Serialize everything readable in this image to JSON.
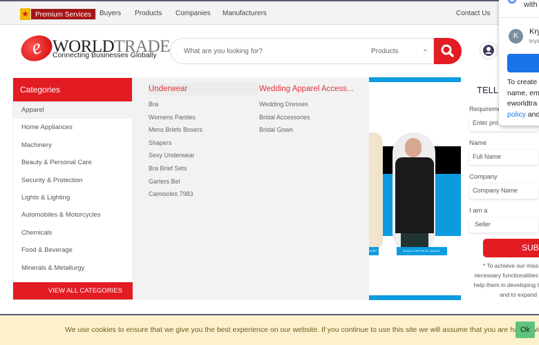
{
  "topnav": {
    "premium": "Premium Services",
    "items": [
      "Buyers",
      "Products",
      "Companies",
      "Manufacturers"
    ],
    "contact": "Contact Us"
  },
  "logo": {
    "brand1": "WORLD",
    "brand2": "TRADE",
    "tagline": "Connecting Businesses Globally"
  },
  "search": {
    "placeholder": "What are you looking for?",
    "category": "Products"
  },
  "categories": {
    "title": "Categories",
    "items": [
      "Apparel",
      "Home Appliances",
      "Machinery",
      "Beauty & Personal Care",
      "Security & Protection",
      "Lights & Lighting",
      "Automobiles  & Motorcycles",
      "Chemicals",
      "Food & Beverage",
      "Minerals & Metallurgy"
    ],
    "view_all": "VIEW ALL CATEGORIES"
  },
  "mega": {
    "columns": [
      {
        "title": "Underwear",
        "links": [
          "Bra",
          "Womens Panties",
          "Mens Briefs Boxers",
          "Shapers",
          "Sexy Underwear",
          "Bra Brief Sets",
          "Garters Bel",
          "Camisoles 7983"
        ]
      },
      {
        "title": "Wedding Apparel Access...",
        "links": [
          "Wedding Dresses",
          "Bridal Accessories",
          "Bridal Gown"
        ]
      }
    ]
  },
  "banner": {
    "caption1": "BLACK SYNTHETIC JACKET",
    "caption0": "SHIRT"
  },
  "form": {
    "title": "TELL",
    "req_label": "Requireme",
    "req_placeholder": "Enter pro",
    "name_label": "Name",
    "name_placeholder": "Full Name",
    "company_label": "Company",
    "company_placeholder": "Company Name",
    "role_label": "I am a",
    "role_value": "Seller",
    "submit": "SUBN",
    "note": [
      "* To achieve our missio",
      "necessary functionalities t",
      "help them in developing th",
      "and to expand"
    ]
  },
  "google": {
    "header": "with",
    "initial": "K",
    "name": "Kry",
    "email": "krys",
    "text": [
      "To create",
      "name, em",
      "eworldtra"
    ],
    "link": "policy",
    "after": " and"
  },
  "cookie": {
    "text": "We use cookies to ensure that we give you the best experience on our website. If you continue to use this site we will assume that you are happy with it.",
    "ok": "Ok"
  },
  "colors": {
    "accent": "#e31b23",
    "banner_blue": "#0d9be0"
  }
}
